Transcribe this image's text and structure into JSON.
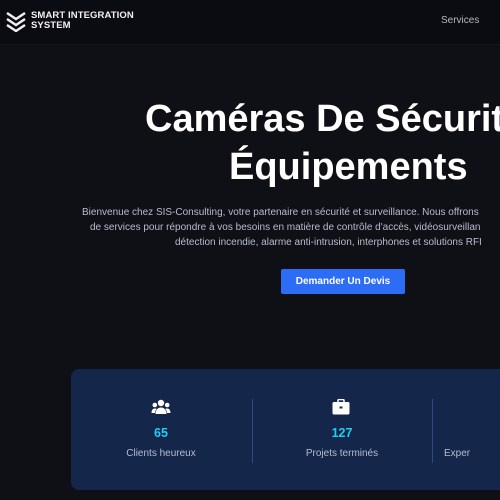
{
  "brand": {
    "line1": "SMART INTEGRATION",
    "line2": "SYSTEM",
    "logo_icon": "chevron-stack-icon"
  },
  "nav": {
    "services_label": "Services"
  },
  "hero": {
    "title_line1": "Caméras De Sécurité",
    "title_line2": "Équipements",
    "desc_line1": "Bienvenue chez SIS-Consulting, votre partenaire en sécurité et surveillance. Nous offrons",
    "desc_line2": "de services pour répondre à vos besoins en matière de contrôle d'accès, vidéosurveillan",
    "desc_line3": "détection incendie, alarme anti-intrusion, interphones et solutions RFI",
    "cta_label": "Demander Un Devis"
  },
  "stats": [
    {
      "icon": "users-icon",
      "value": "65",
      "label": "Clients heureux"
    },
    {
      "icon": "briefcase-icon",
      "value": "127",
      "label": "Projets terminés"
    },
    {
      "icon": "",
      "value": "",
      "label": "Exper"
    }
  ],
  "colors": {
    "background": "#0f0f16",
    "accent": "#2d6df6",
    "stat_value": "#1bd0f0",
    "stats_panel": "#14264a"
  }
}
